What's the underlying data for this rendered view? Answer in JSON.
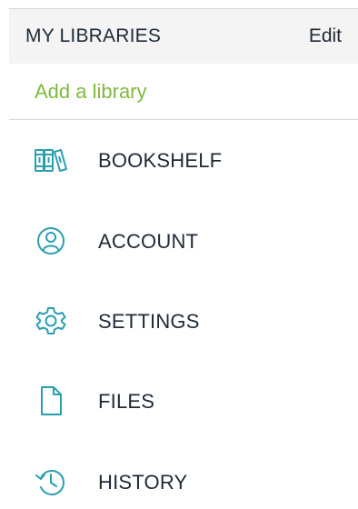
{
  "libraries": {
    "title": "MY LIBRARIES",
    "edit_label": "Edit",
    "add_label": "Add a library"
  },
  "menu": {
    "items": [
      {
        "label": "BOOKSHELF",
        "icon": "bookshelf-icon"
      },
      {
        "label": "ACCOUNT",
        "icon": "account-icon"
      },
      {
        "label": "SETTINGS",
        "icon": "gear-icon"
      },
      {
        "label": "FILES",
        "icon": "file-icon"
      },
      {
        "label": "HISTORY",
        "icon": "history-icon"
      }
    ]
  },
  "colors": {
    "accent_green": "#7fba3f",
    "icon_teal": "#2a9fb0",
    "text_dark": "#1f2a36",
    "header_bg": "#f4f4f4"
  }
}
